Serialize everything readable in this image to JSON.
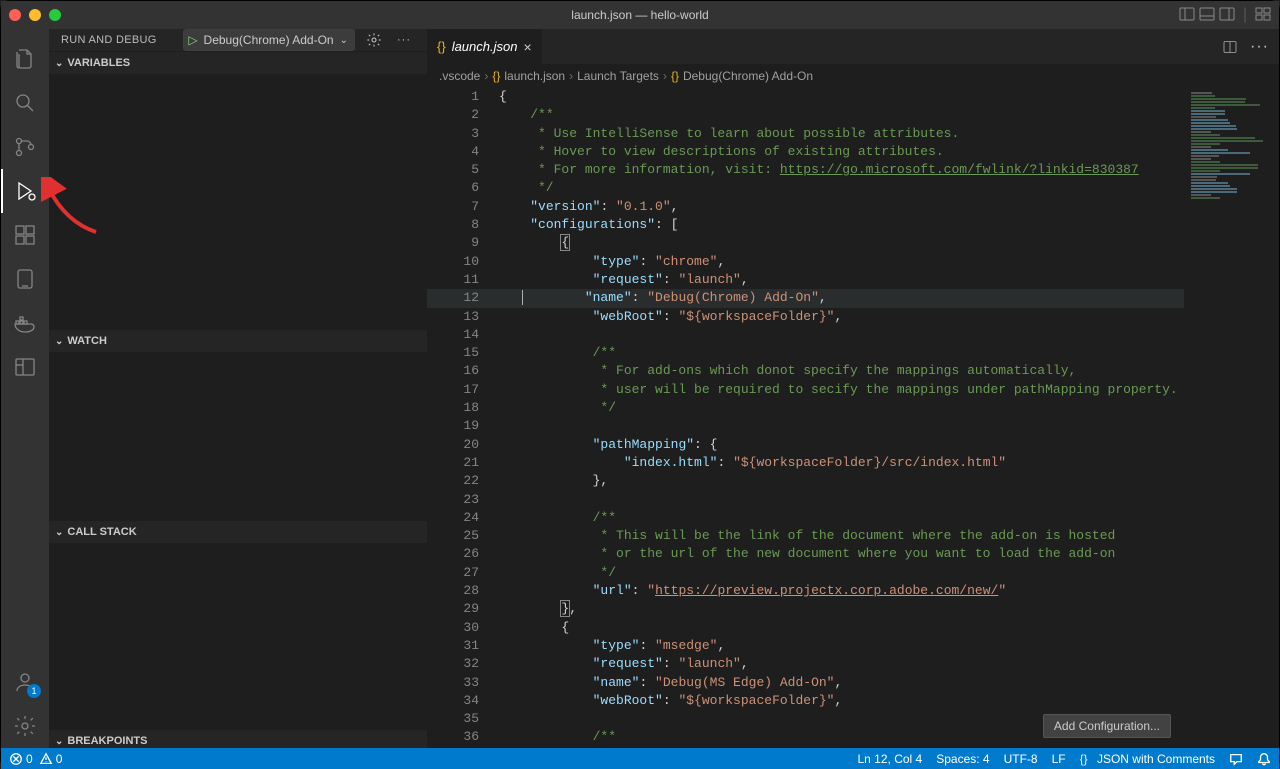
{
  "window": {
    "title": "launch.json — hello-world"
  },
  "sidebar": {
    "title": "RUN AND DEBUG",
    "debug_config": "Debug(Chrome) Add-On",
    "sections": {
      "variables": "VARIABLES",
      "watch": "WATCH",
      "callstack": "CALL STACK",
      "breakpoints": "BREAKPOINTS"
    }
  },
  "tab": {
    "filename": "launch.json"
  },
  "breadcrumb": {
    "folder": ".vscode",
    "file": "launch.json",
    "node1": "Launch Targets",
    "node2": "Debug(Chrome) Add-On"
  },
  "code": {
    "lines": [
      {
        "n": 1,
        "html": "<span class='t-punct'>{</span>"
      },
      {
        "n": 2,
        "html": "    <span class='t-comment'>/**</span>"
      },
      {
        "n": 3,
        "html": "<span class='t-comment'>     * Use IntelliSense to learn about possible attributes.</span>"
      },
      {
        "n": 4,
        "html": "<span class='t-comment'>     * Hover to view descriptions of existing attributes.</span>"
      },
      {
        "n": 5,
        "html": "<span class='t-comment'>     * For more information, visit: <span class='t-link'>https://go.microsoft.com/fwlink/?linkid=830387</span></span>"
      },
      {
        "n": 6,
        "html": "<span class='t-comment'>     */</span>"
      },
      {
        "n": 7,
        "html": "    <span class='t-key'>\"version\"</span><span class='t-punct'>: </span><span class='t-str'>\"0.1.0\"</span><span class='t-punct'>,</span>"
      },
      {
        "n": 8,
        "html": "    <span class='t-key'>\"configurations\"</span><span class='t-punct'>: [</span>"
      },
      {
        "n": 9,
        "html": "        <span class='t-punct bracket-hl'>{</span>"
      },
      {
        "n": 10,
        "html": "            <span class='t-key'>\"type\"</span><span class='t-punct'>: </span><span class='t-str'>\"chrome\"</span><span class='t-punct'>,</span>"
      },
      {
        "n": 11,
        "html": "            <span class='t-key'>\"request\"</span><span class='t-punct'>: </span><span class='t-str'>\"launch\"</span><span class='t-punct'>,</span>"
      },
      {
        "n": 12,
        "hl": true,
        "html": "   <span class='cursor-ib'></span>        <span class='t-key'>\"name\"</span><span class='t-punct'>: </span><span class='t-str'>\"Debug(Chrome) Add-On\"</span><span class='t-punct'>,</span>"
      },
      {
        "n": 13,
        "html": "            <span class='t-key'>\"webRoot\"</span><span class='t-punct'>: </span><span class='t-str'>\"${workspaceFolder}\"</span><span class='t-punct'>,</span>"
      },
      {
        "n": 14,
        "html": ""
      },
      {
        "n": 15,
        "html": "            <span class='t-comment'>/**</span>"
      },
      {
        "n": 16,
        "html": "<span class='t-comment'>             * For add-ons which donot specify the mappings automatically,</span>"
      },
      {
        "n": 17,
        "html": "<span class='t-comment'>             * user will be required to secify the mappings under pathMapping property.</span>"
      },
      {
        "n": 18,
        "html": "<span class='t-comment'>             */</span>"
      },
      {
        "n": 19,
        "html": ""
      },
      {
        "n": 20,
        "html": "            <span class='t-key'>\"pathMapping\"</span><span class='t-punct'>: {</span>"
      },
      {
        "n": 21,
        "html": "                <span class='t-key'>\"index.html\"</span><span class='t-punct'>: </span><span class='t-str'>\"${workspaceFolder}/src/index.html\"</span>"
      },
      {
        "n": 22,
        "html": "            <span class='t-punct'>},</span>"
      },
      {
        "n": 23,
        "html": ""
      },
      {
        "n": 24,
        "html": "            <span class='t-comment'>/**</span>"
      },
      {
        "n": 25,
        "html": "<span class='t-comment'>             * This will be the link of the document where the add-on is hosted</span>"
      },
      {
        "n": 26,
        "html": "<span class='t-comment'>             * or the url of the new document where you want to load the add-on</span>"
      },
      {
        "n": 27,
        "html": "<span class='t-comment'>             */</span>"
      },
      {
        "n": 28,
        "html": "            <span class='t-key'>\"url\"</span><span class='t-punct'>: </span><span class='t-str'>\"<span class='t-link'>https://preview.projectx.corp.adobe.com/new/</span>\"</span>"
      },
      {
        "n": 29,
        "html": "        <span class='t-punct bracket-hl'>}</span><span class='t-punct'>,</span>"
      },
      {
        "n": 30,
        "html": "        <span class='t-punct'>{</span>"
      },
      {
        "n": 31,
        "html": "            <span class='t-key'>\"type\"</span><span class='t-punct'>: </span><span class='t-str'>\"msedge\"</span><span class='t-punct'>,</span>"
      },
      {
        "n": 32,
        "html": "            <span class='t-key'>\"request\"</span><span class='t-punct'>: </span><span class='t-str'>\"launch\"</span><span class='t-punct'>,</span>"
      },
      {
        "n": 33,
        "html": "            <span class='t-key'>\"name\"</span><span class='t-punct'>: </span><span class='t-str'>\"Debug(MS Edge) Add-On\"</span><span class='t-punct'>,</span>"
      },
      {
        "n": 34,
        "html": "            <span class='t-key'>\"webRoot\"</span><span class='t-punct'>: </span><span class='t-str'>\"${workspaceFolder}\"</span><span class='t-punct'>,</span>"
      },
      {
        "n": 35,
        "html": ""
      },
      {
        "n": 36,
        "html": "            <span class='t-comment'>/**</span>"
      }
    ]
  },
  "addConfigBtn": "Add Configuration...",
  "status": {
    "errors": "0",
    "warnings": "0",
    "cursor": "Ln 12, Col 4",
    "spaces": "Spaces: 4",
    "encoding": "UTF-8",
    "eol": "LF",
    "lang": "JSON with Comments"
  },
  "accountBadge": "1"
}
